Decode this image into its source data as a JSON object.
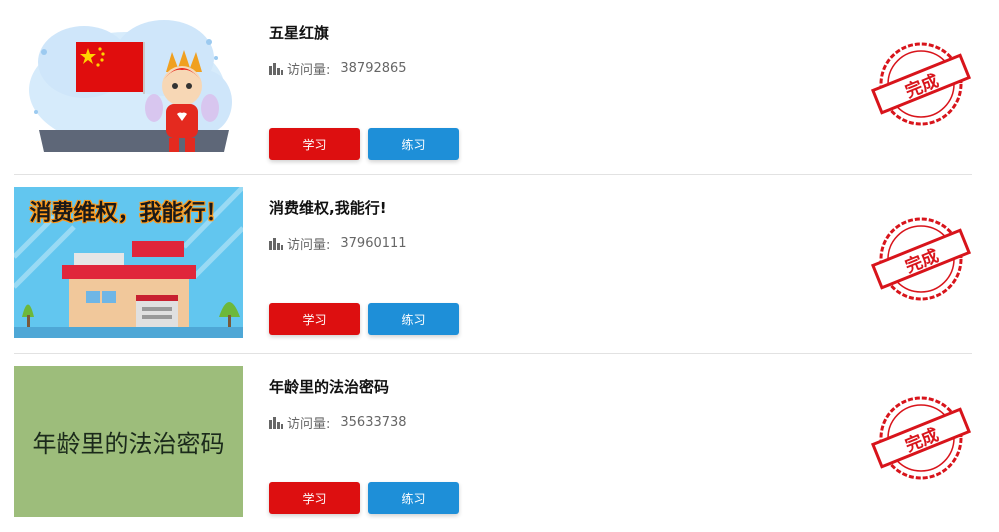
{
  "items": [
    {
      "title": "五星红旗",
      "visits_label": "访问量:",
      "visits_count": "38792865",
      "study_label": "学习",
      "practice_label": "练习",
      "stamp_text": "完成",
      "thumb_text": ""
    },
    {
      "title": "消费维权,我能行!",
      "visits_label": "访问量:",
      "visits_count": "37960111",
      "study_label": "学习",
      "practice_label": "练习",
      "stamp_text": "完成",
      "thumb_text": "消费维权，我能行！"
    },
    {
      "title": "年龄里的法治密码",
      "visits_label": "访问量:",
      "visits_count": "35633738",
      "study_label": "学习",
      "practice_label": "练习",
      "stamp_text": "完成",
      "thumb_text": "年龄里的法治密码"
    }
  ],
  "colors": {
    "study_button": "#dd0f10",
    "practice_button": "#1e8fd8",
    "stamp": "#d8141b",
    "thumb3_bg": "#9dbd7b"
  },
  "icons": {
    "visits": "bar-chart-icon",
    "stamp": "completed-stamp-icon"
  }
}
